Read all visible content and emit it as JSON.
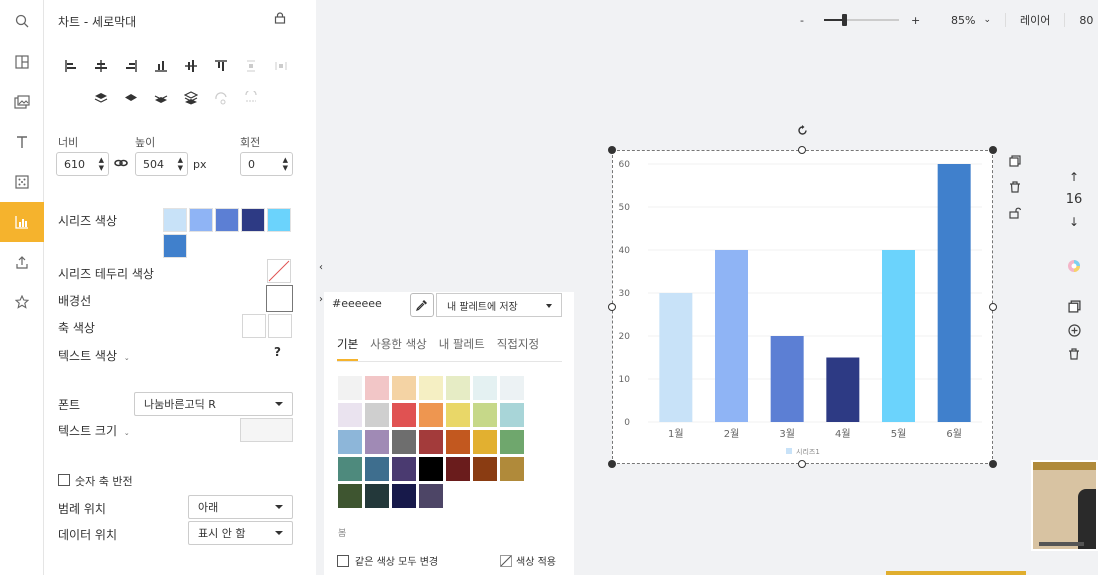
{
  "panel": {
    "title": "차트 - 세로막대",
    "width_label": "너비",
    "height_label": "높이",
    "rotate_label": "회전",
    "width_value": "610",
    "height_value": "504",
    "unit": "px",
    "rotate_value": "0",
    "series_color_label": "시리즈 색상",
    "series_border_label": "시리즈 테두리 색상",
    "gridline_label": "배경선",
    "axis_color_label": "축 색상",
    "text_color_label": "텍스트 색상",
    "help": "?",
    "font_label": "폰트",
    "font_value": "나눔바른고딕 R",
    "text_size_label": "텍스트 크기",
    "reverse_label": "숫자 축 반전",
    "legend_pos_label": "범례 위치",
    "legend_pos_value": "아래",
    "data_pos_label": "데이터 위치",
    "data_pos_value": "표시 안 함",
    "series_swatches": [
      "#c8e2f8",
      "#8fb4f5",
      "#5c7fd4",
      "#2d3a84",
      "#6bd3fc",
      "#4080cc"
    ]
  },
  "colorpicker": {
    "hex": "#eeeeee",
    "save_label": "내 팔레트에 저장",
    "tabs": [
      "기본",
      "사용한 색상",
      "내 팔레트",
      "직접지정"
    ],
    "palette": [
      "#f2f2f2",
      "#f2c6c7",
      "#f4d3a4",
      "#f5efc3",
      "#e6ecc5",
      "#e4f1f2",
      "#ecf2f4",
      "#eae3ef",
      "#cfcfcf",
      "#e05252",
      "#ee9650",
      "#e9d768",
      "#c6d889",
      "#a8d5d8",
      "#8db6d9",
      "#a08ab5",
      "#6e6e6e",
      "#a33b3b",
      "#c2581f",
      "#e2b030",
      "#6fa76d",
      "#4e8a7d",
      "#3e6e8e",
      "#4a3a70",
      "#000000",
      "#6a1c1c",
      "#8a3c12",
      "#b08a3a",
      "#3e5530",
      "#23383a",
      "#17194a",
      "#4d4566"
    ],
    "season_label": "봄",
    "same_change_label": "같은 색상 모두 변경",
    "apply_label": "색상 적용"
  },
  "topbar": {
    "zoom_minus": "-",
    "zoom_plus": "+",
    "zoom_level": "85%",
    "layer_label": "레이어",
    "cut_label": "80",
    "zoom_fraction": 0.27
  },
  "pageno": "16",
  "chart_data": {
    "type": "bar",
    "categories": [
      "1월",
      "2월",
      "3월",
      "4월",
      "5월",
      "6월"
    ],
    "values": [
      30,
      40,
      20,
      15,
      40,
      60
    ],
    "colors": [
      "#c8e2f8",
      "#8fb4f5",
      "#5c7fd4",
      "#2d3a84",
      "#6bd3fc",
      "#4080cc"
    ],
    "ylim": [
      0,
      60
    ],
    "yticks": [
      0,
      10,
      20,
      30,
      40,
      50,
      60
    ],
    "legend": [
      "시리즈1"
    ],
    "legend_position": "bottom",
    "grid": true
  }
}
